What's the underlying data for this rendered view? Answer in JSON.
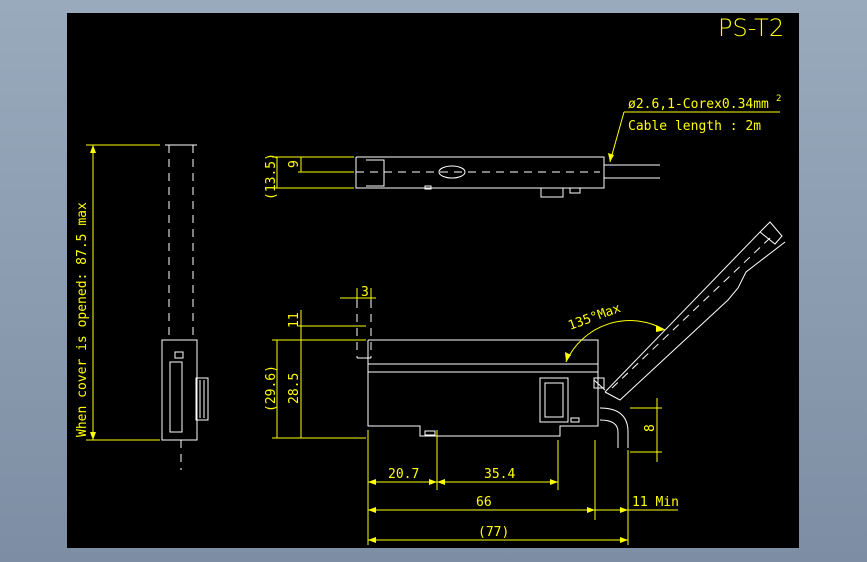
{
  "drawing": {
    "title": "PS-T2",
    "cable_line1": "ø2.6,1-Corex0.34mm",
    "cable_sup": "2",
    "cable_line2": "Cable length : 2m",
    "cover_note": "When cover is opened: 87.5 max",
    "dim_135": "135°Max",
    "dim_3": "3",
    "dim_11a": "11",
    "dim_29_6": "(29.6)",
    "dim_28_5": "28.5",
    "dim_13_5": "(13.5)",
    "dim_9": "9",
    "dim_8": "8",
    "dim_20_7": "20.7",
    "dim_35_4": "35.4",
    "dim_66": "66",
    "dim_11min": "11 Min",
    "dim_77": "(77)"
  },
  "colors": {
    "background": "#000000",
    "outline": "#ffffff",
    "dimension": "#ffff00"
  }
}
